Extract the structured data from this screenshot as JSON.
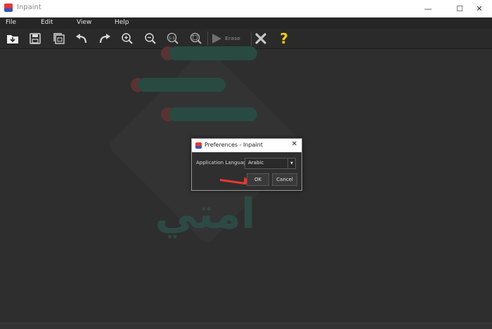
{
  "window": {
    "title": "Inpaint",
    "controls": {
      "minimize": "—",
      "maximize": "☐",
      "close": "✕"
    }
  },
  "menu": {
    "items": [
      "File",
      "Edit",
      "View",
      "Help"
    ]
  },
  "toolbar": {
    "tools": [
      {
        "name": "open-icon"
      },
      {
        "name": "save-icon"
      },
      {
        "name": "save-as-icon"
      },
      {
        "name": "undo-icon"
      },
      {
        "name": "redo-icon"
      },
      {
        "name": "zoom-in-icon"
      },
      {
        "name": "zoom-out-icon"
      },
      {
        "name": "actual-size-icon"
      },
      {
        "name": "fit-icon"
      }
    ],
    "actual_size_label": "1:1",
    "erase_label": "Erase",
    "help_label": "?"
  },
  "watermark": {
    "text": "امتي"
  },
  "dialog": {
    "title": "Preferences - Inpaint",
    "close_label": "✕",
    "language_label": "Application Language",
    "language_value": "Arabic",
    "ok_label": "OK",
    "cancel_label": "Cancel"
  },
  "colors": {
    "canvas": "#2e2e2e",
    "menubar": "#262626",
    "accent_yellow": "#f5d000",
    "annotation_red": "#e53935"
  }
}
